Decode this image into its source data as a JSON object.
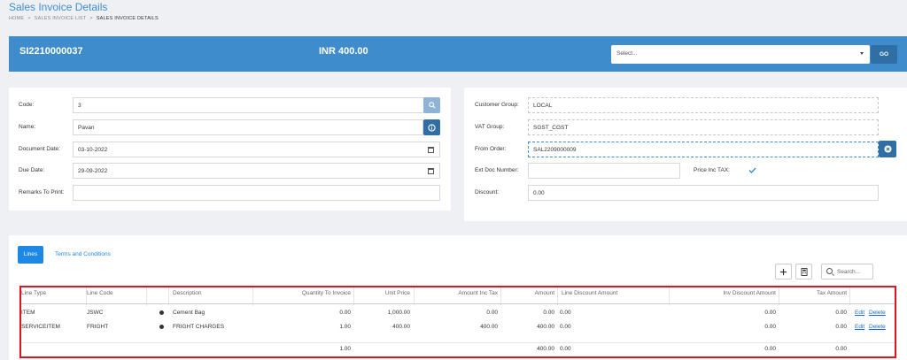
{
  "page": {
    "title": "Sales Invoice Details"
  },
  "breadcrumb": [
    "HOME",
    "SALES INVOICE LIST",
    "SALES INVOICE DETAILS"
  ],
  "breadcrumb_sep": ">",
  "banner": {
    "doc_no": "SI2210000037",
    "amount": "INR 400.00",
    "select_placeholder": "Select...",
    "go_label": "GO"
  },
  "form_left": {
    "code_label": "Code:",
    "code_value": "3",
    "name_label": "Name:",
    "name_value": "Pavan",
    "doc_date_label": "Document Date:",
    "doc_date_value": "03-10-2022",
    "due_date_label": "Due Date:",
    "due_date_value": "29-09-2022",
    "remarks_label": "Remarks To Print:",
    "remarks_value": ""
  },
  "form_right": {
    "customer_group_label": "Customer Group:",
    "customer_group_value": "LOCAL",
    "vat_group_label": "VAT Group:",
    "vat_group_value": "SGST_CGST",
    "from_order_label": "From Order:",
    "from_order_value": "SAL2209000009",
    "ext_doc_label": "Ext Doc Number:",
    "ext_doc_value": "",
    "price_inc_tax_label": "Price Inc TAX:",
    "price_inc_tax_checked": true,
    "discount_label": "Discount:",
    "discount_value": "0.00"
  },
  "tabs": {
    "lines": "Lines",
    "terms": "Terms and Conditions"
  },
  "toolbar": {
    "search_placeholder": "Search..."
  },
  "grid": {
    "headers": [
      "Line Type",
      "Line Code",
      "",
      "Description",
      "Quantity To Invoice",
      "Unit Price",
      "Amount Inc Tax",
      "Amount",
      "Line Discount Amount",
      "Inv Discount Amount",
      "Tax Amount"
    ],
    "rows": [
      {
        "line_type": "ITEM",
        "line_code": "JSWC",
        "description": "Cement Bag",
        "qty": "0.00",
        "unit_price": "1,000.00",
        "amount_inc_tax": "0.00",
        "amount": "0.00",
        "line_discount": "0.00",
        "inv_discount": "0.00",
        "tax_amount": "0.00",
        "edit": "Edit",
        "delete": "Delete"
      },
      {
        "line_type": "SERVICEITEM",
        "line_code": "FRIGHT",
        "description": "FRIGHT CHARGES",
        "qty": "1.00",
        "unit_price": "400.00",
        "amount_inc_tax": "400.00",
        "amount": "400.00",
        "line_discount": "0.00",
        "inv_discount": "0.00",
        "tax_amount": "0.00",
        "edit": "Edit",
        "delete": "Delete"
      }
    ],
    "totals": {
      "qty": "1.00",
      "amount": "400.00",
      "line_discount": "0.00",
      "inv_discount": "0.00",
      "tax_amount": "0.00"
    }
  },
  "colors": {
    "accent": "#3f8ccc",
    "primary_button": "#1e88e5",
    "highlight_border": "#e0141e"
  }
}
